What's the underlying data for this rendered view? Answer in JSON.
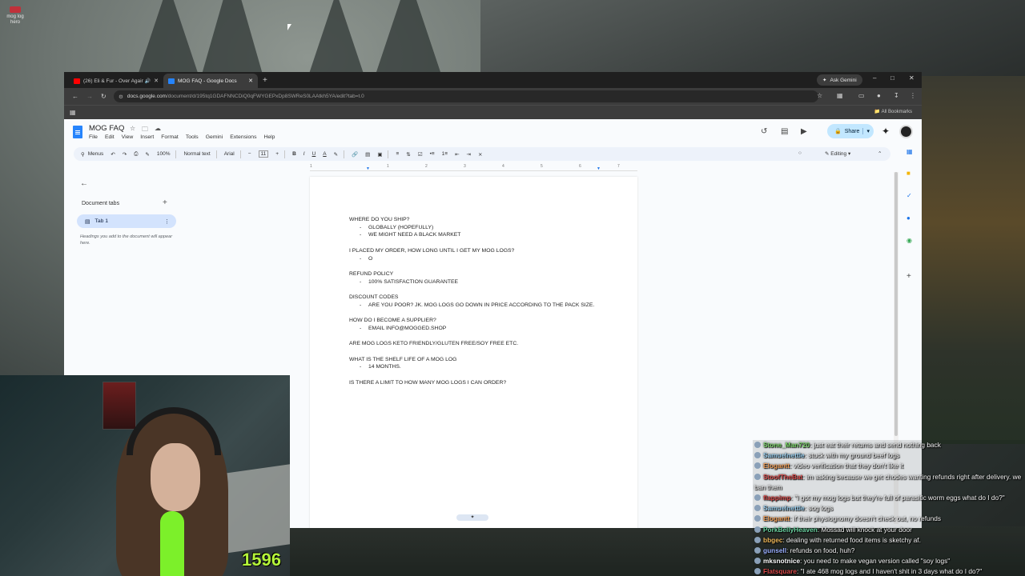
{
  "desktop": {
    "icon_label_line1": "mog log",
    "icon_label_line2": "hero"
  },
  "browser": {
    "tabs": [
      {
        "title": "(26) Eli & Fur - Over Again",
        "favicon_color": "#ff0000"
      },
      {
        "title": "MOG FAQ - Google Docs",
        "favicon_color": "#2684fc"
      }
    ],
    "ask_gemini": "Ask Gemini",
    "url_host": "docs.google.com",
    "url_path": "/document/d/195tq1GDAFNNCDiQ0qFWYGEPxDp8SWReS0LAAtkh5YA/edit?tab=t.0",
    "all_bookmarks": "All Bookmarks"
  },
  "docs": {
    "title": "MOG FAQ",
    "menu": [
      "File",
      "Edit",
      "View",
      "Insert",
      "Format",
      "Tools",
      "Gemini",
      "Extensions",
      "Help"
    ],
    "share_label": "Share",
    "toolbar": {
      "menus": "Menus",
      "zoom": "100%",
      "style": "Normal text",
      "font": "Arial",
      "font_size": "11",
      "mode": "Editing"
    },
    "ruler_ticks": [
      "1",
      "1",
      "2",
      "3",
      "4",
      "5",
      "6",
      "7"
    ],
    "sidebar": {
      "title": "Document tabs",
      "tab_label": "Tab 1",
      "hint": "Headings you add to the document will appear here."
    },
    "content": {
      "q1": "WHERE DO YOU SHIP?",
      "q1_a1": "GLOBALLY (HOPEFULLY)",
      "q1_a2": "WE MIGHT NEED A BLACK MARKET",
      "q2": "I PLACED MY ORDER, HOW LONG UNTIL I GET MY MOG LOGS?",
      "q2_a1": "O",
      "q3": "REFUND POLICY",
      "q3_a1": "100% SATISFACTION GUARANTEE",
      "q4": "DISCOUNT CODES",
      "q4_a1": "ARE YOU POOR? JK. MOG LOGS GO DOWN IN PRICE ACCORDING TO THE PACK SIZE.",
      "q5": "HOW DO I BECOME A SUPPLIER?",
      "q5_a1": "EMAIL INFO@MOGGED.SHOP",
      "q6": "ARE MOG LOGS KETO FRIENDLY/GLUTEN FREE/SOY FREE ETC.",
      "q7": "WHAT IS THE SHELF LIFE OF A MOG LOG",
      "q7_a1": "14 MONTHS.",
      "q8": "IS THERE A LIMIT TO HOW MANY MOG LOGS I CAN ORDER?"
    }
  },
  "stream": {
    "counter": "1596",
    "chat": [
      {
        "user": "Stone_Man720",
        "color": "#7cd66a",
        "text": "just eat their returns and send nothing back"
      },
      {
        "user": "Samuelnettle",
        "color": "#9ad0f0",
        "text": "stuck with my ground beef logs"
      },
      {
        "user": "Elogantt",
        "color": "#f2a15a",
        "text": "video verification that they don't like it"
      },
      {
        "user": "StoofTheBat",
        "color": "#d94a4a",
        "text": "im asking because we get chodes wanting refunds right after delivery. we ban them"
      },
      {
        "user": "flappimp",
        "color": "#d94a4a",
        "text": "\"I got my mog logs but they're full of parasitic worm eggs what do I do?\""
      },
      {
        "user": "Samuelnettle",
        "color": "#9ad0f0",
        "text": "sog logs"
      },
      {
        "user": "Elogantt",
        "color": "#f2a15a",
        "text": "if their physiognomy doesn't check out, no refunds"
      },
      {
        "user": "PorkBellyHeaven",
        "color": "#6ad2a0",
        "text": "Mossad will knock at your door"
      },
      {
        "user": "bbgec",
        "color": "#f0b95a",
        "text": "dealing with returned food items is sketchy af."
      },
      {
        "user": "gunsell",
        "color": "#9ab0ff",
        "text": "refunds on food, huh?"
      },
      {
        "user": "mksnotnice",
        "color": "#ffffff",
        "text": "you need to make vegan version called \"soy logs\""
      },
      {
        "user": "Flatsquare",
        "color": "#d94a4a",
        "text": "\"I ate 468 mog logs and I haven't shit in 3 days what do I do?\""
      }
    ]
  }
}
